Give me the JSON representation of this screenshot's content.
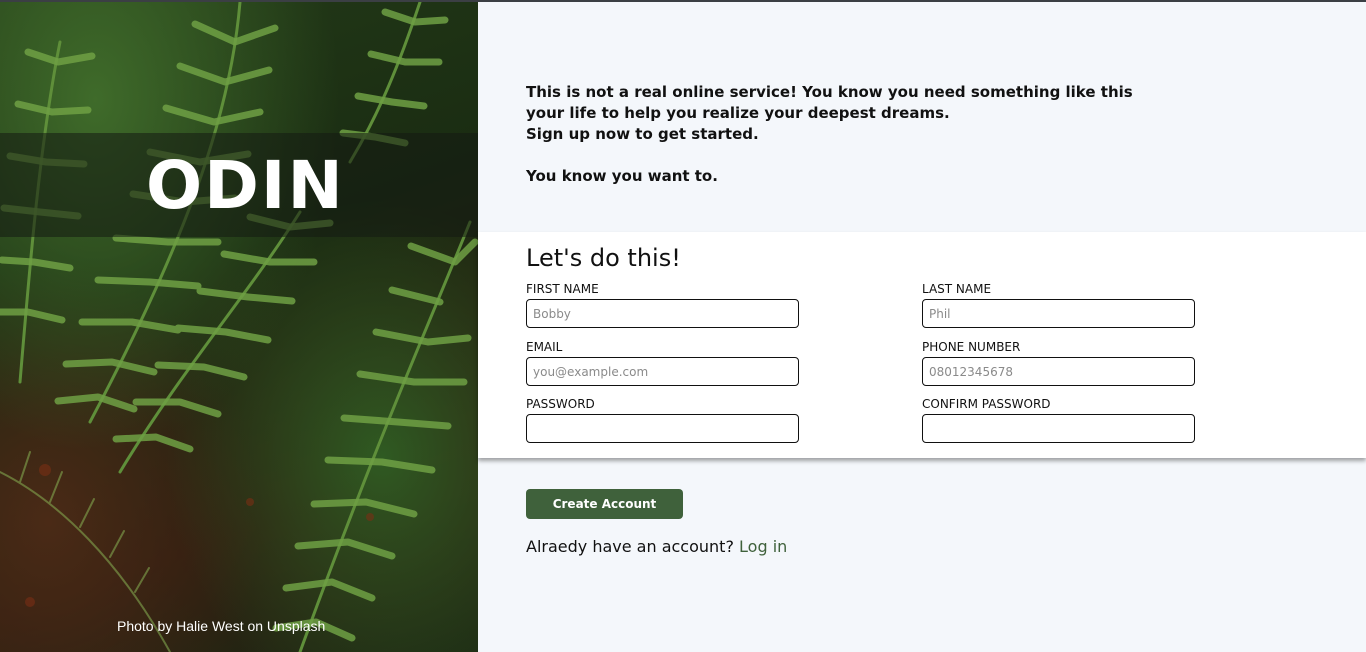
{
  "hero": {
    "logo_text": "ODIN",
    "photo_credit": "Photo by Halie West on Unsplash"
  },
  "intro": {
    "line1": "This is not a real online service! You know you need something like this your life to help you realize your deepest dreams.",
    "line2": "Sign up now to get started.",
    "line3": "You know you want to."
  },
  "form": {
    "title": "Let's do this!",
    "first_name": {
      "label": "FIRST NAME",
      "placeholder": "Bobby",
      "value": ""
    },
    "last_name": {
      "label": "LAST NAME",
      "placeholder": "Phil",
      "value": ""
    },
    "email": {
      "label": "EMAIL",
      "placeholder": "you@example.com",
      "value": ""
    },
    "phone": {
      "label": "PHONE NUMBER",
      "placeholder": "08012345678",
      "value": ""
    },
    "password": {
      "label": "PASSWORD",
      "placeholder": "",
      "value": ""
    },
    "confirm_password": {
      "label": "CONFIRM PASSWORD",
      "placeholder": "",
      "value": ""
    }
  },
  "actions": {
    "create_label": "Create Account",
    "login_prompt": "Alraedy have an account?",
    "login_link": "Log in"
  },
  "colors": {
    "accent": "#3f613b",
    "background": "#f4f7fb",
    "card": "#ffffff"
  },
  "icons": {
    "logo": "viking-helmet-icon"
  }
}
